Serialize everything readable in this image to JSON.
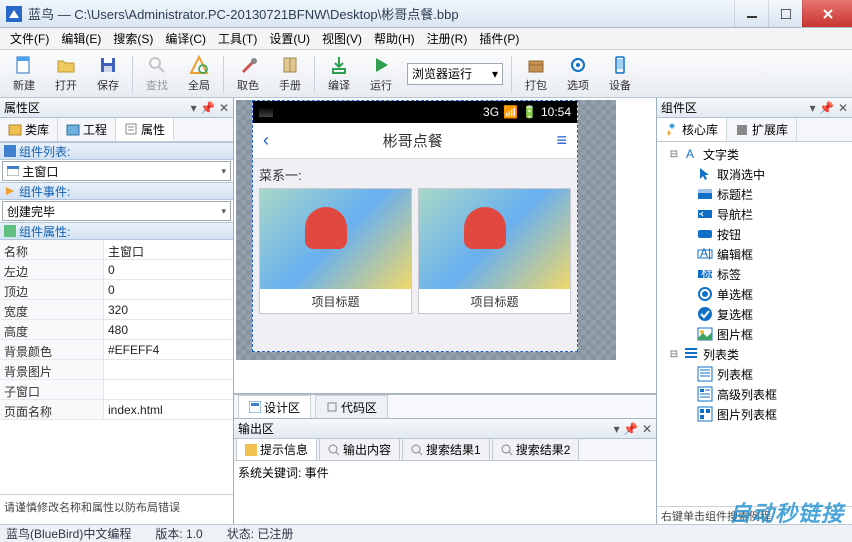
{
  "window": {
    "title": "蓝鸟 — C:\\Users\\Administrator.PC-20130721BFNW\\Desktop\\彬哥点餐.bbp"
  },
  "menubar": [
    "文件(F)",
    "编辑(E)",
    "搜索(S)",
    "编译(C)",
    "工具(T)",
    "设置(U)",
    "视图(V)",
    "帮助(H)",
    "注册(R)",
    "插件(P)"
  ],
  "toolbar": {
    "new": "新建",
    "open": "打开",
    "save": "保存",
    "find": "查找",
    "global": "全局",
    "pick": "取色",
    "manual": "手册",
    "compile": "编译",
    "run": "运行",
    "runmode": "浏览器运行",
    "pack": "打包",
    "options": "选项",
    "device": "设备"
  },
  "left": {
    "title": "属性区",
    "tabs": {
      "lib": "类库",
      "proj": "工程",
      "props": "属性"
    },
    "sec_list": "组件列表:",
    "combo_main": "主窗口",
    "sec_event": "组件事件:",
    "combo_event": "创建完毕",
    "sec_props": "组件属性:",
    "rows": [
      {
        "k": "名称",
        "v": "主窗口"
      },
      {
        "k": "左边",
        "v": "0"
      },
      {
        "k": "顶边",
        "v": "0"
      },
      {
        "k": "宽度",
        "v": "320"
      },
      {
        "k": "高度",
        "v": "480"
      },
      {
        "k": "背景颜色",
        "v": "#EFEFF4"
      },
      {
        "k": "背景图片",
        "v": ""
      },
      {
        "k": "子窗口",
        "v": ""
      },
      {
        "k": "页面名称",
        "v": "index.html"
      }
    ],
    "footer": "请谨慎修改名称和属性以防布局错误"
  },
  "center": {
    "canvas": {
      "status_net": "3G",
      "status_time": "10:54",
      "nav_title": "彬哥点餐",
      "category": "菜系一:",
      "card_caption": "项目标题"
    },
    "tabs": {
      "design": "设计区",
      "code": "代码区"
    },
    "output": {
      "title": "输出区",
      "tabs": [
        "提示信息",
        "输出内容",
        "搜索结果1",
        "搜索结果2"
      ],
      "body": "系统关键词: 事件"
    }
  },
  "right": {
    "title": "组件区",
    "tabs": {
      "core": "核心库",
      "ext": "扩展库"
    },
    "tree": [
      {
        "lv": 1,
        "icon": "text",
        "label": "文字类",
        "exp": "⊟"
      },
      {
        "lv": 2,
        "icon": "cursor",
        "label": "取消选中"
      },
      {
        "lv": 2,
        "icon": "titlebar",
        "label": "标题栏"
      },
      {
        "lv": 2,
        "icon": "navbar",
        "label": "导航栏"
      },
      {
        "lv": 2,
        "icon": "button",
        "label": "按钮"
      },
      {
        "lv": 2,
        "icon": "edit",
        "label": "编辑框"
      },
      {
        "lv": 2,
        "icon": "label",
        "label": "标签"
      },
      {
        "lv": 2,
        "icon": "radio",
        "label": "单选框"
      },
      {
        "lv": 2,
        "icon": "check",
        "label": "复选框"
      },
      {
        "lv": 2,
        "icon": "image",
        "label": "图片框"
      },
      {
        "lv": 1,
        "icon": "list",
        "label": "列表类",
        "exp": "⊟"
      },
      {
        "lv": 2,
        "icon": "listbox",
        "label": "列表框"
      },
      {
        "lv": 2,
        "icon": "advlist",
        "label": "高级列表框"
      },
      {
        "lv": 2,
        "icon": "imglist",
        "label": "图片列表框"
      }
    ],
    "footer": "右键单击组件搜索例程"
  },
  "status": {
    "app": "蓝鸟(BlueBird)中文编程",
    "ver_lbl": "版本: ",
    "ver": "1.0",
    "state_lbl": "状态: ",
    "state": "已注册"
  },
  "watermark": "自动秒链接"
}
